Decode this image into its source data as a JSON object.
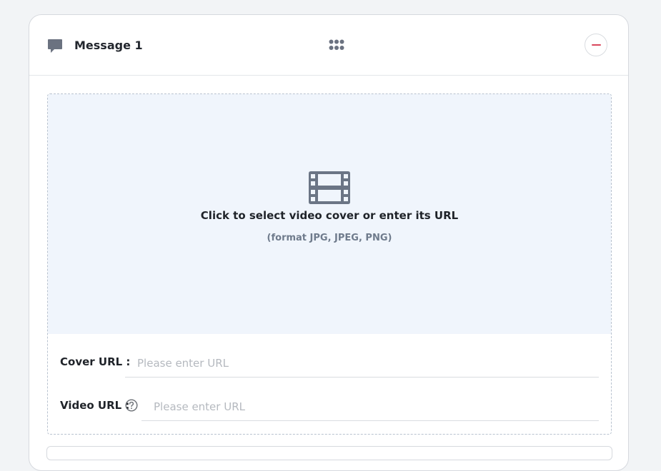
{
  "message": {
    "title": "Message 1",
    "icons": {
      "message": "chat-bubble-icon",
      "drag": "grip-dots-icon",
      "remove": "minus-circle-icon"
    }
  },
  "upload": {
    "icon": "film-icon",
    "title": "Click to select video cover or enter its URL",
    "hint": "(format JPG, JPEG, PNG)"
  },
  "fields": {
    "cover": {
      "label": "Cover URL :",
      "placeholder": "Please enter URL",
      "value": ""
    },
    "video": {
      "label": "Video URL :",
      "placeholder": "Please enter URL",
      "value": "",
      "help_icon": "question-circle-icon"
    }
  },
  "colors": {
    "page_background": "#f2f4f6",
    "drop_zone_background": "#f0f5fc",
    "icon_gray": "#6b7280",
    "remove_accent": "#d9475c"
  }
}
